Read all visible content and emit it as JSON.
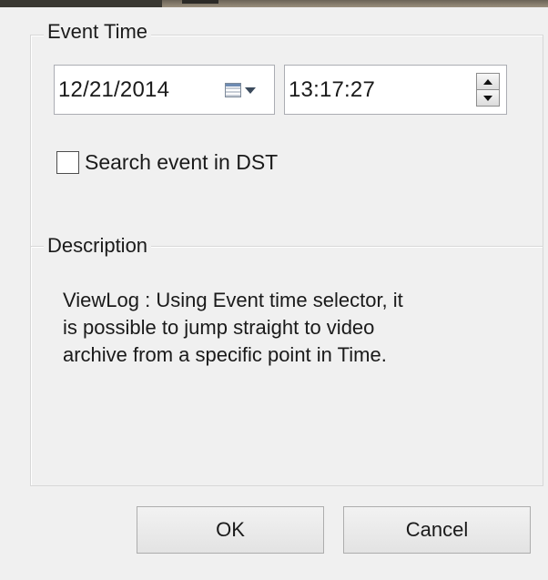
{
  "event_time": {
    "legend": "Event Time",
    "date_value": "12/21/2014",
    "time_value": "13:17:27",
    "dst_checkbox": {
      "label": "Search event in DST",
      "checked": false
    }
  },
  "description": {
    "legend": "Description",
    "line1": "ViewLog : Using Event time selector, it",
    "line2": "is possible to jump straight to video",
    "line3": "archive from a specific point in Time."
  },
  "buttons": {
    "ok_label": "OK",
    "cancel_label": "Cancel"
  },
  "icons": {
    "calendar": "calendar-icon",
    "dropdown": "chevron-down-icon",
    "spin_up": "arrow-up-icon",
    "spin_down": "arrow-down-icon"
  }
}
